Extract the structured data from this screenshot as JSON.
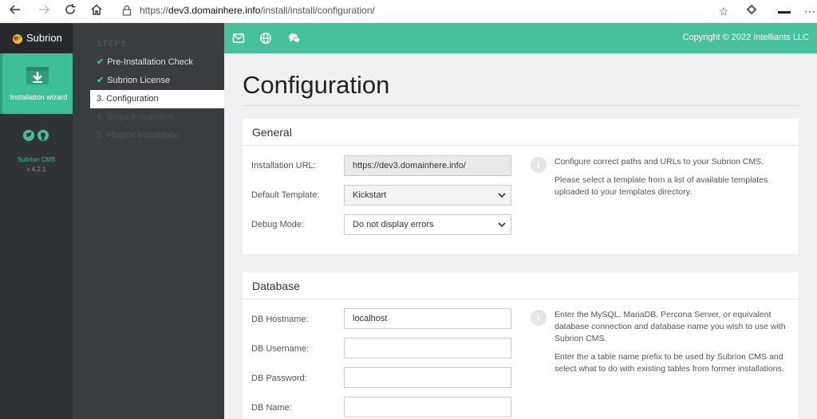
{
  "browser": {
    "url_prefix": "https://",
    "url_host": "dev3.domainhere.info",
    "url_path": "/install/install/configuration/"
  },
  "sidebar": {
    "brand": "Subrion",
    "wizard_label": "Installation wizard",
    "cms_name": "Subrion CMS",
    "version": "v 4.2.1"
  },
  "steps": {
    "title": "STEPS",
    "items": [
      {
        "label": "Pre-Installation Check",
        "state": "done"
      },
      {
        "label": "Subrion License",
        "state": "done"
      },
      {
        "label": "3. Configuration",
        "state": "active"
      },
      {
        "label": "4. Script Installation",
        "state": "todo"
      },
      {
        "label": "5. Plugins Installation",
        "state": "todo"
      }
    ]
  },
  "topbar": {
    "copyright": "Copyright © 2022 Intelliants LLC",
    "icons": [
      "mail-icon",
      "globe-icon",
      "chat-icon"
    ]
  },
  "page": {
    "title": "Configuration"
  },
  "general": {
    "heading": "General",
    "url_label": "Installation URL:",
    "url_value": "https://dev3.domainhere.info/",
    "template_label": "Default Template:",
    "template_value": "Kickstart",
    "debug_label": "Debug Mode:",
    "debug_value": "Do not display errors",
    "help1": "Configure correct paths and URLs to your Subrion CMS.",
    "help2": "Please select a template from a list of available templates uploaded to your templates directory."
  },
  "database": {
    "heading": "Database",
    "host_label": "DB Hostname:",
    "host_value": "localhost",
    "user_label": "DB Username:",
    "user_value": "",
    "pass_label": "DB Password:",
    "pass_value": "",
    "name_label": "DB Name:",
    "name_value": "",
    "help1": "Enter the MySQL, MariaDB, Percona Server, or equivalent database connection and database name you wish to use with Subrion CMS.",
    "help2": "Enter the a table name prefix to be used by Subrion CMS and select what to do with existing tables from former installations."
  },
  "colors": {
    "accent": "#46c09d",
    "rail": "#303437",
    "steps_bg": "#393d40"
  }
}
